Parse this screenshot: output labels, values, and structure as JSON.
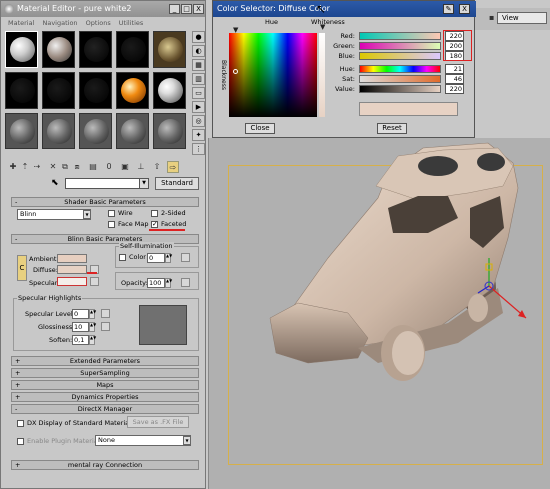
{
  "material_editor": {
    "title": "Material Editor - pure white2",
    "menu": [
      "Material",
      "Navigation",
      "Options",
      "Utilities"
    ],
    "window_buttons": [
      "_",
      "□",
      "X"
    ],
    "material_name": "",
    "type_button": "Standard",
    "sidebar_icons": [
      "sample-type-icon",
      "backlight-icon",
      "background-icon",
      "uv-tiling-icon",
      "video-check-icon",
      "make-preview-icon",
      "options-icon",
      "select-by-material-icon",
      "material-navigator-icon"
    ],
    "toolbar_icons": [
      "get-material-icon",
      "put-to-scene-icon",
      "assign-to-selection-icon",
      "reset-icon",
      "make-copy-icon",
      "make-unique-icon",
      "put-to-library-icon",
      "material-id-icon",
      "show-map-icon",
      "show-end-result-icon",
      "go-to-parent-icon",
      "go-forward-icon"
    ],
    "shader_basic": {
      "header": "Shader Basic Parameters",
      "shader": "Blinn",
      "wire_label": "Wire",
      "two_sided_label": "2-Sided",
      "face_map_label": "Face Map",
      "faceted_label": "Faceted",
      "faceted_checked": "✓"
    },
    "blinn_basic": {
      "header": "Blinn Basic Parameters",
      "self_illum_label": "Self-Illumination",
      "color_label": "Color",
      "color_value": "0",
      "ambient_label": "Ambient:",
      "diffuse_label": "Diffuse:",
      "specular_label": "Specular:",
      "opacity_label": "Opacity:",
      "opacity_value": "100",
      "lock_label": "C",
      "ambient_color": "#e7cfc0",
      "diffuse_color": "#e7d2c4",
      "specular_color": "#f4eeea"
    },
    "specular_highlights": {
      "header": "Specular Highlights",
      "level_label": "Specular Level:",
      "level_value": "0",
      "gloss_label": "Glossiness:",
      "gloss_value": "10",
      "soften_label": "Soften:",
      "soften_value": "0,1"
    },
    "rollups": [
      "Extended Parameters",
      "SuperSampling",
      "Maps",
      "Dynamics Properties",
      "DirectX Manager"
    ],
    "directx": {
      "dx_display_label": "DX Display of Standard Material",
      "save_fx_label": "Save as .FX File",
      "enable_plugin_label": "Enable Plugin Material",
      "plugin_value": "None"
    },
    "mental_ray": "mental ray Connection"
  },
  "color_selector": {
    "title": "Color Selector: Diffuse Color",
    "hue_label": "Hue",
    "whiteness_label": "Whiteness",
    "blackness_label": "Blackness",
    "sliders": [
      {
        "label": "Red:",
        "value": "220"
      },
      {
        "label": "Green:",
        "value": "200"
      },
      {
        "label": "Blue:",
        "value": "180"
      },
      {
        "label": "Hue:",
        "value": "21"
      },
      {
        "label": "Sat:",
        "value": "46"
      },
      {
        "label": "Value:",
        "value": "220"
      }
    ],
    "close_label": "Close",
    "reset_label": "Reset",
    "preview_color": "#e7d2c4"
  },
  "viewport": {
    "view_dropdown": "View"
  }
}
